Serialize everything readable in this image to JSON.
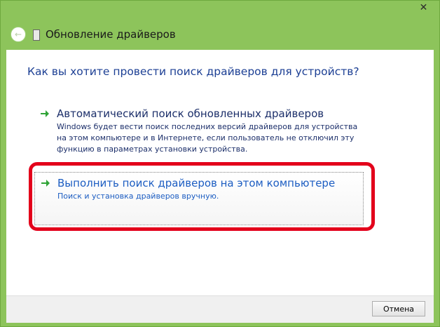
{
  "window": {
    "close_label": "✕",
    "back_arrow": "←"
  },
  "header": {
    "title": "Обновление драйверов"
  },
  "main": {
    "question": "Как вы хотите провести поиск драйверов для устройств?",
    "options": [
      {
        "title": "Автоматический поиск обновленных драйверов",
        "description": "Windows будет вести поиск последних версий драйверов для устройства на этом компьютере и в Интернете, если пользователь не отключил эту функцию в параметрах установки устройства.",
        "icon": "green-arrow-icon"
      },
      {
        "title": "Выполнить поиск драйверов на этом компьютере",
        "description": "Поиск и установка драйверов вручную.",
        "icon": "green-arrow-icon"
      }
    ]
  },
  "footer": {
    "cancel_label": "Отмена"
  },
  "colors": {
    "titlebar": "#8dc45b",
    "link_text": "#1c5dc2",
    "highlight_border": "#e3001b",
    "arrow": "#2fa336"
  }
}
